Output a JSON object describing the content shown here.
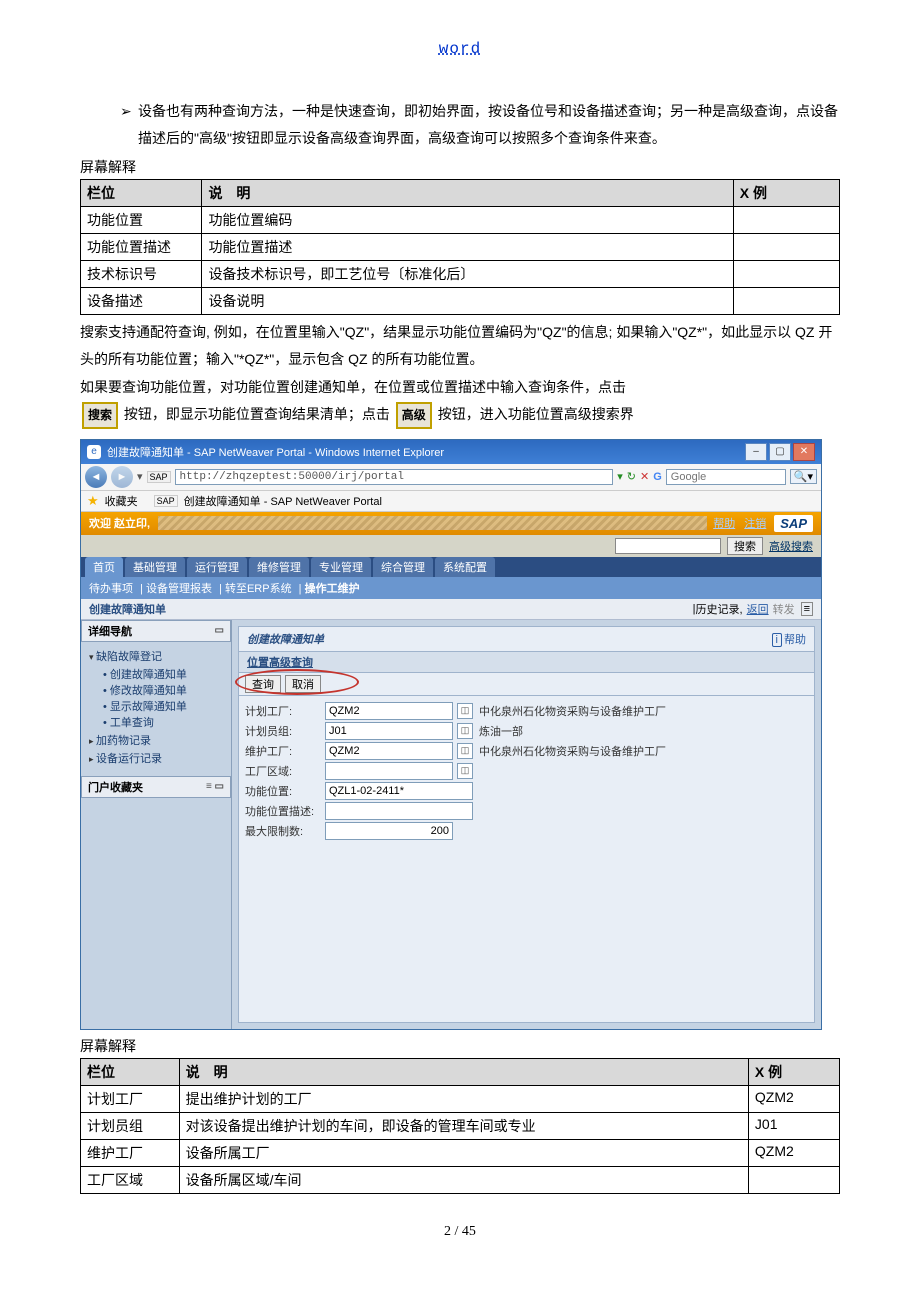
{
  "header": {
    "word": "word"
  },
  "intro": {
    "bullet_arrow": "➢",
    "text": "设备也有两种查询方法，一种是快速查询，即初始界面，按设备位号和设备描述查询；另一种是高级查询，点设备描述后的\"高级\"按钮即显示设备高级查询界面，高级查询可以按照多个查询条件来查。"
  },
  "screen_label": "屏幕解释",
  "table1": {
    "headers": {
      "col1": "栏位",
      "col2": "说　明",
      "col3": "X 例"
    },
    "rows": [
      {
        "c1": "功能位置",
        "c2": "功能位置编码",
        "c3": ""
      },
      {
        "c1": "功能位置描述",
        "c2": "功能位置描述",
        "c3": ""
      },
      {
        "c1": "技术标识号",
        "c2": "设备技术标识号，即工艺位号〔标准化后〕",
        "c3": ""
      },
      {
        "c1": "设备描述",
        "c2": "设备说明",
        "c3": ""
      }
    ]
  },
  "para1": "搜索支持通配符查询, 例如，在位置里输入\"QZ\"，结果显示功能位置编码为\"QZ\"的信息; 如果输入\"QZ*\"，如此显示以 QZ 开头的所有功能位置；输入\"*QZ*\"，显示包含 QZ 的所有功能位置。",
  "para2_pre": "如果要查询功能位置，对功能位置创建通知单，在位置或位置描述中输入查询条件，点击",
  "para2_btn1": "搜索",
  "para2_mid": "按钮，即显示功能位置查询结果清单；点击",
  "para2_btn2": "高级",
  "para2_post": "按钮，进入功能位置高级搜索界",
  "sap": {
    "window_title": "创建故障通知单 - SAP NetWeaver Portal - Windows Internet Explorer",
    "url": "http://zhqzeptest:50000/irj/portal",
    "search_placeholder": "Google",
    "favorites": "收藏夹",
    "fav_tab": "创建故障通知单 - SAP NetWeaver Portal",
    "welcome": "欢迎 赵立印,",
    "top_links": {
      "help": "帮助",
      "logout": "注销"
    },
    "sap_logo": "SAP",
    "top_search_btn": "搜索",
    "top_search_adv": "高级搜索",
    "tabs": [
      "首页",
      "基础管理",
      "运行管理",
      "维修管理",
      "专业管理",
      "综合管理",
      "系统配置"
    ],
    "subnav": {
      "items": [
        "待办事项",
        "设备管理报表",
        "转至ERP系统"
      ],
      "active": "操作工维护"
    },
    "breadcrumb": "创建故障通知单",
    "history_label": "历史记录,",
    "history_back": "返回",
    "history_fwd": "转发",
    "left": {
      "sec1": "详细导航",
      "grp1": "缺陷故障登记",
      "items1": [
        "创建故障通知单",
        "修改故障通知单",
        "显示故障通知单",
        "工单查询"
      ],
      "grp2": "加药物记录",
      "grp3": "设备运行记录",
      "sec2": "门户收藏夹"
    },
    "form": {
      "title": "创建故障通知单",
      "help": "帮助",
      "subsection": "位置高级查询",
      "btn_query": "查询",
      "btn_cancel": "取消",
      "rows": [
        {
          "label": "计划工厂:",
          "value": "QZM2",
          "desc": "中化泉州石化物资采购与设备维护工厂"
        },
        {
          "label": "计划员组:",
          "value": "J01",
          "desc": "炼油一部"
        },
        {
          "label": "维护工厂:",
          "value": "QZM2",
          "desc": "中化泉州石化物资采购与设备维护工厂"
        },
        {
          "label": "工厂区域:",
          "value": ""
        },
        {
          "label": "功能位置:",
          "value": "QZL1-02-2411*"
        },
        {
          "label": "功能位置描述:",
          "value": ""
        },
        {
          "label": "最大限制数:",
          "value": "200"
        }
      ]
    }
  },
  "table2": {
    "headers": {
      "col1": "栏位",
      "col2": "说　明",
      "col3": "X 例"
    },
    "rows": [
      {
        "c1": "计划工厂",
        "c2": "提出维护计划的工厂",
        "c3": "QZM2"
      },
      {
        "c1": "计划员组",
        "c2": "对该设备提出维护计划的车间，即设备的管理车间或专业",
        "c3": "J01"
      },
      {
        "c1": "维护工厂",
        "c2": "设备所属工厂",
        "c3": "QZM2"
      },
      {
        "c1": "工厂区域",
        "c2": "设备所属区域/车间",
        "c3": ""
      }
    ]
  },
  "footer": "2 / 45"
}
